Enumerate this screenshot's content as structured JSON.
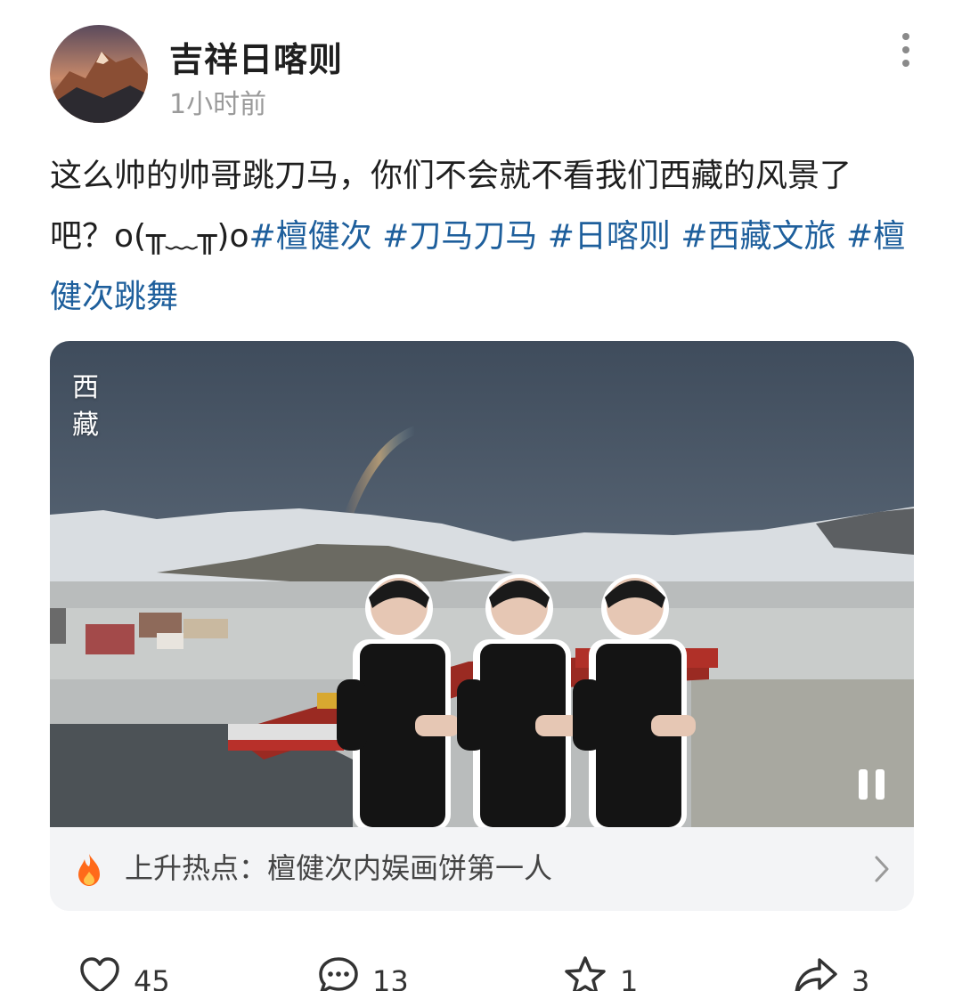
{
  "post": {
    "username": "吉祥日喀则",
    "timestamp": "1小时前",
    "text_plain": "这么帅的帅哥跳刀马，你们不会就不看我们西藏的风景了吧？o(╥﹏╥)o",
    "hashtags": [
      "#檀健次",
      "#刀马刀马",
      "#日喀则",
      "#西藏文旅",
      "#檀健次跳舞"
    ]
  },
  "media": {
    "overlay_text": "西藏",
    "hot_topic": "上升热点：檀健次内娱画饼第一人"
  },
  "actions": {
    "likes": "45",
    "comments": "13",
    "favorites": "1",
    "shares": "3"
  },
  "colors": {
    "hashtag": "#1e5f9c",
    "flame": "#ff6a1a",
    "muted": "#9a9a9a"
  },
  "icons": [
    "more-icon",
    "pause-icon",
    "flame-icon",
    "chevron-right-icon",
    "heart-icon",
    "comment-icon",
    "star-icon",
    "share-icon"
  ]
}
